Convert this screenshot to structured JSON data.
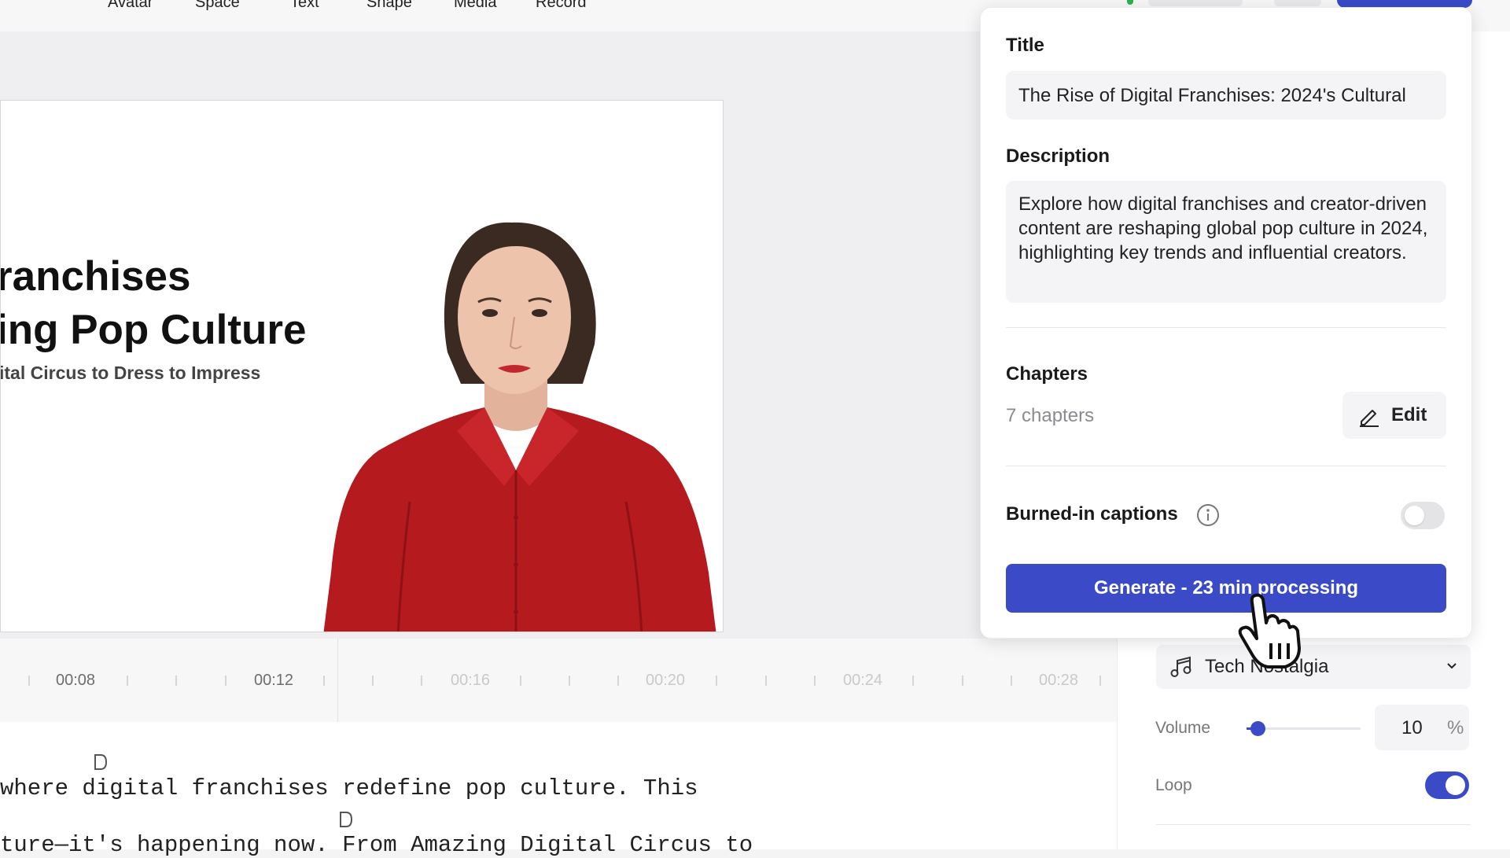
{
  "toolbar": {
    "items": [
      "Avatar",
      "Space",
      "Text",
      "Shape",
      "Media",
      "Record"
    ]
  },
  "slide": {
    "heading_line1": "ranchises",
    "heading_line2": "ing Pop Culture",
    "subtitle": "ital Circus to Dress to Impress"
  },
  "timeline": {
    "labels": [
      "00:08",
      "00:12",
      "00:16",
      "00:20",
      "00:24",
      "00:28"
    ]
  },
  "script": {
    "line1": " where digital franchises redefine pop culture. This",
    "line2": "ture—it's happening now. From Amazing Digital Circus to"
  },
  "popover": {
    "title_label": "Title",
    "title_value": "The Rise of Digital Franchises: 2024's Cultural",
    "description_label": "Description",
    "description_value": "Explore how digital franchises and creator-driven content are reshaping global pop culture in 2024, highlighting key trends and influential creators.",
    "chapters_label": "Chapters",
    "chapters_count": "7 chapters",
    "edit_label": "Edit",
    "captions_label": "Burned-in captions",
    "captions_enabled": false,
    "generate_label": "Generate - 23 min processing"
  },
  "music": {
    "track": "Tech Nostalgia",
    "volume_label": "Volume",
    "volume_value": "10",
    "volume_unit": "%",
    "volume_fraction": 0.1,
    "loop_label": "Loop",
    "loop_enabled": true
  },
  "colors": {
    "accent": "#3b4bc8",
    "shirt": "#b51a1e"
  }
}
